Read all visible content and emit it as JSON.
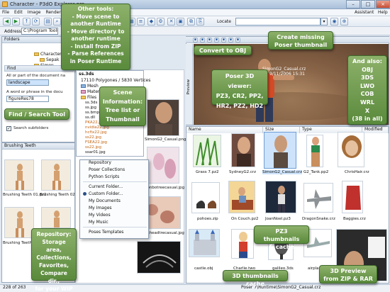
{
  "window": {
    "title": "Character - P3dO Explorer pro"
  },
  "menu": {
    "items": [
      "File",
      "Edit",
      "Image",
      "Render"
    ],
    "right": [
      "Assistant",
      "Help"
    ]
  },
  "toolbar": {
    "locate_label": "Locate",
    "locate_value": "",
    "address_label": "Address",
    "address_value": "C:\\Program Tools"
  },
  "folders": {
    "header": "Folders",
    "tree": [
      "Character",
      "Sepak",
      "Simon"
    ]
  },
  "find": {
    "header": "Find",
    "label1": "All or part of the document na",
    "value1": "landscape",
    "label2": "A word or phrase in the docu",
    "value2": "figureRes78",
    "subfolders": "Search subfolders"
  },
  "scene": {
    "file": "ss.3ds",
    "stats": "17110 Polygones / 5830 Vertices",
    "nodes": [
      "Mesh",
      "Material",
      "Files"
    ],
    "files": [
      "ss.3ds",
      "ss.jpg",
      "ss.bmp",
      "ss.dll",
      "PKA22.jpg",
      "nvidia22.jpg",
      "hcfix22.jpg",
      "ss22.jpg",
      "FSEA22.jpg",
      "ss22.jpg",
      "ssar01.jpg"
    ]
  },
  "brushing": {
    "header": "Brushing Teeth",
    "captions": [
      "Brushing Teeth 01.pz2",
      "Brushing Teeth 02.pz2",
      "Brushing Teeth 03.pz2",
      "Brushing Teeth 04.pz2"
    ]
  },
  "preview": {
    "title_file": "SimonG2_Casual.crz",
    "date": "9/11/2006 15:31",
    "side_label": "Preview"
  },
  "context_menu": {
    "items": [
      "Repository",
      "Poser Collections",
      "Python Scripts",
      "Current Folder...",
      "Custom Folder...",
      "My Documents",
      "My Images",
      "My Videos",
      "My Music",
      "Poses Templates"
    ]
  },
  "middle_captions": [
    "SimonG2_Casual.png",
    "bonbotreecasual.jpg",
    "yawnheadtrecasual.jpg"
  ],
  "list": {
    "columns": [
      "Name",
      "Size",
      "Type",
      "Modified"
    ],
    "row1": [
      "Grass 7.pz2",
      "SydneyG2.crz",
      "SimonG2_Casual.crz",
      "G2_Tank.pp2",
      "ChrisHair.crz"
    ],
    "row2": [
      "pohoes.zip",
      "On Couch.pz2",
      "JoanNoel.pz3",
      "DragonSnake.crz",
      "Baggies.crz"
    ],
    "row3": [
      "castle.obj",
      "Charlie.two",
      "galileo.3ds",
      "airplane.lwo",
      ""
    ]
  },
  "callouts": {
    "other_tools": [
      "Other tools:",
      "- Move scene to",
      "another Runtime",
      "- Move directory to",
      "another runtime",
      "- Install from ZIP",
      "- Parse References",
      "in Poser Runtime"
    ],
    "convert_obj": "Convert to OBJ",
    "missing_thumb": [
      "Create missing",
      "Poser thumbnail"
    ],
    "viewer": [
      "Poser 3D viewer:",
      "PZ3, CR2, PP2,",
      "HR2, PZ2, HD2"
    ],
    "also": [
      "And also:",
      "OBJ",
      "3DS",
      "LWO",
      "COB",
      "WRL",
      "X",
      "(38 in all)"
    ],
    "scene_info": [
      "Scene",
      "Information:",
      "Tree list or",
      "Thumbnail"
    ],
    "find_search": "Find / Search Tool",
    "repository": [
      "Repository:",
      "Storage area,",
      "Collections,",
      "Favorites,",
      "Compare dir.,",
      "for your WIP"
    ],
    "pz3_thumbs": [
      "PZ3 thumbnails",
      "& cache"
    ],
    "thumbs_cache": "3D thumbnails cache",
    "preview_zip": [
      "3D Preview",
      "from ZIP & RAR"
    ]
  },
  "status": {
    "left": "228 of 263",
    "path": "Poser 7\\Runtime\\SimonG2_Casual.crz"
  },
  "colors": {
    "callout_green": "#6e9a4c",
    "selection": "#cde3fb"
  }
}
